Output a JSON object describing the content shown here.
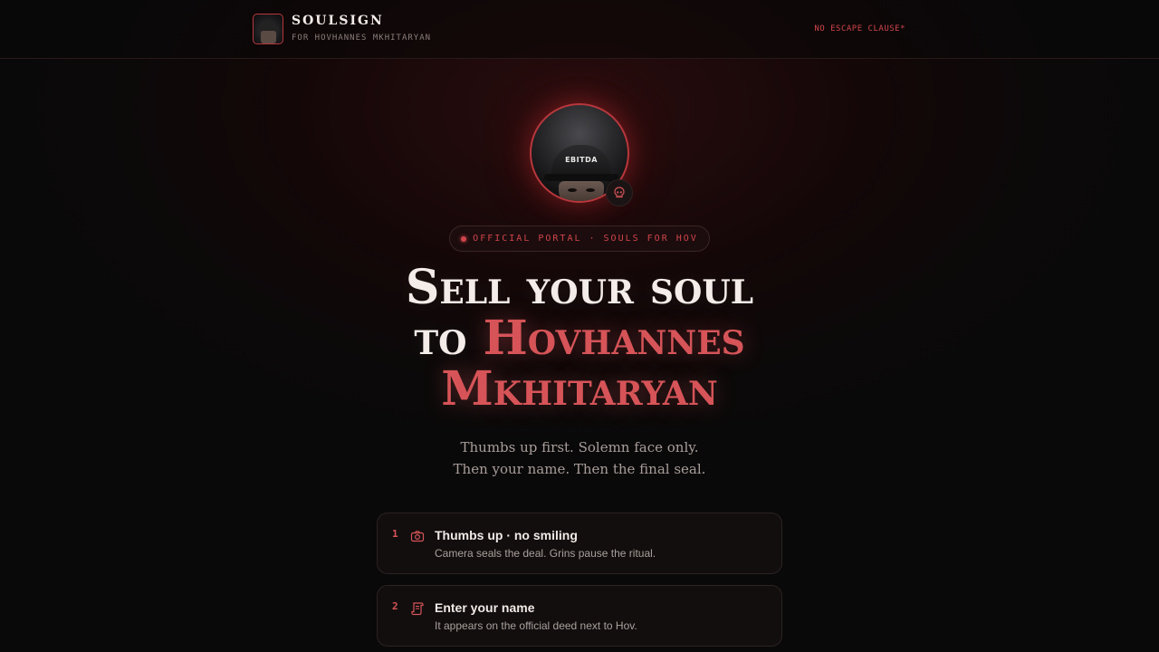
{
  "header": {
    "brand_name": "SOULSIGN",
    "brand_subtitle": "FOR HOVHANNES MKHITARYAN",
    "link_label": "NO ESCAPE CLAUSE*"
  },
  "hero": {
    "avatar_cap_text": "EBITDA",
    "badge_text": "OFFICIAL PORTAL · SOULS FOR HOV",
    "headline_line1": "Sell your soul",
    "headline_to": "to ",
    "headline_name1": "Hovhannes",
    "headline_name2": "Mkhitaryan",
    "subcopy_line1": "Thumbs up first. Solemn face only.",
    "subcopy_line2": "Then your name. Then the final seal."
  },
  "steps": [
    {
      "number": "1",
      "icon": "camera-icon",
      "title": "Thumbs up · no smiling",
      "description": "Camera seals the deal. Grins pause the ritual."
    },
    {
      "number": "2",
      "icon": "scroll-icon",
      "title": "Enter your name",
      "description": "It appears on the official deed next to Hov."
    }
  ],
  "colors": {
    "accent": "#d65458",
    "accent_border": "#b8373c",
    "background": "#0b0909",
    "text": "#f4ece8"
  }
}
